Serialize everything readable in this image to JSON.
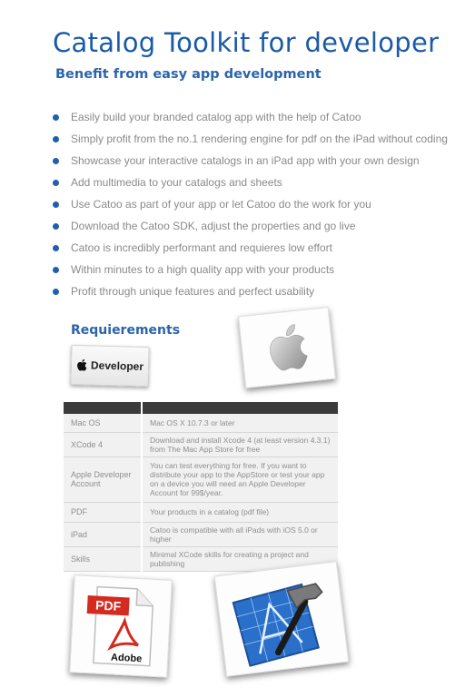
{
  "header": {
    "title": "Catalog Toolkit for developer",
    "subtitle": "Benefit from easy app development"
  },
  "features": [
    "Easily build your branded catalog app with the help of Catoo",
    "Simply profit from the no.1 rendering engine for pdf on the iPad without coding",
    "Showcase your interactive catalogs in an iPad app with your own design",
    "Add multimedia to your catalogs and sheets",
    "Use Catoo as part of your app or let Catoo do the work for you",
    "Download the Catoo SDK, adjust the properties and go live",
    "Catoo is incredibly performant and requieres low effort",
    "Within minutes to a high quality app with your products",
    "Profit through unique features and perfect usability"
  ],
  "requirements": {
    "heading": "Requierements",
    "developer_badge": "Developer",
    "rows": [
      {
        "key": "Mac OS",
        "value": "Mac OS X 10.7.3 or later"
      },
      {
        "key": "XCode 4",
        "value": "Download and install Xcode 4 (at least version 4.3.1) from The Mac App Store for free"
      },
      {
        "key": "Apple Developer Account",
        "value": "You can test everything for free. If you want to distribute your app to the AppStore or test your app on a device you will need an Apple Developer Account for 99$/year."
      },
      {
        "key": "PDF",
        "value": "Your products in a catalog (pdf file)"
      },
      {
        "key": "iPad",
        "value": "Catoo is compatible with all iPads with iOS 5.0 or higher"
      },
      {
        "key": "Skills",
        "value": "Minimal XCode skills for creating a project and publishing"
      }
    ]
  },
  "images": {
    "pdf_label": "PDF",
    "adobe_label": "Adobe"
  },
  "colors": {
    "title_blue": "#1a5aa8",
    "bullet_blue": "#1f5fae",
    "body_gray": "#8a8a8a",
    "table_header": "#3b3b3b"
  }
}
